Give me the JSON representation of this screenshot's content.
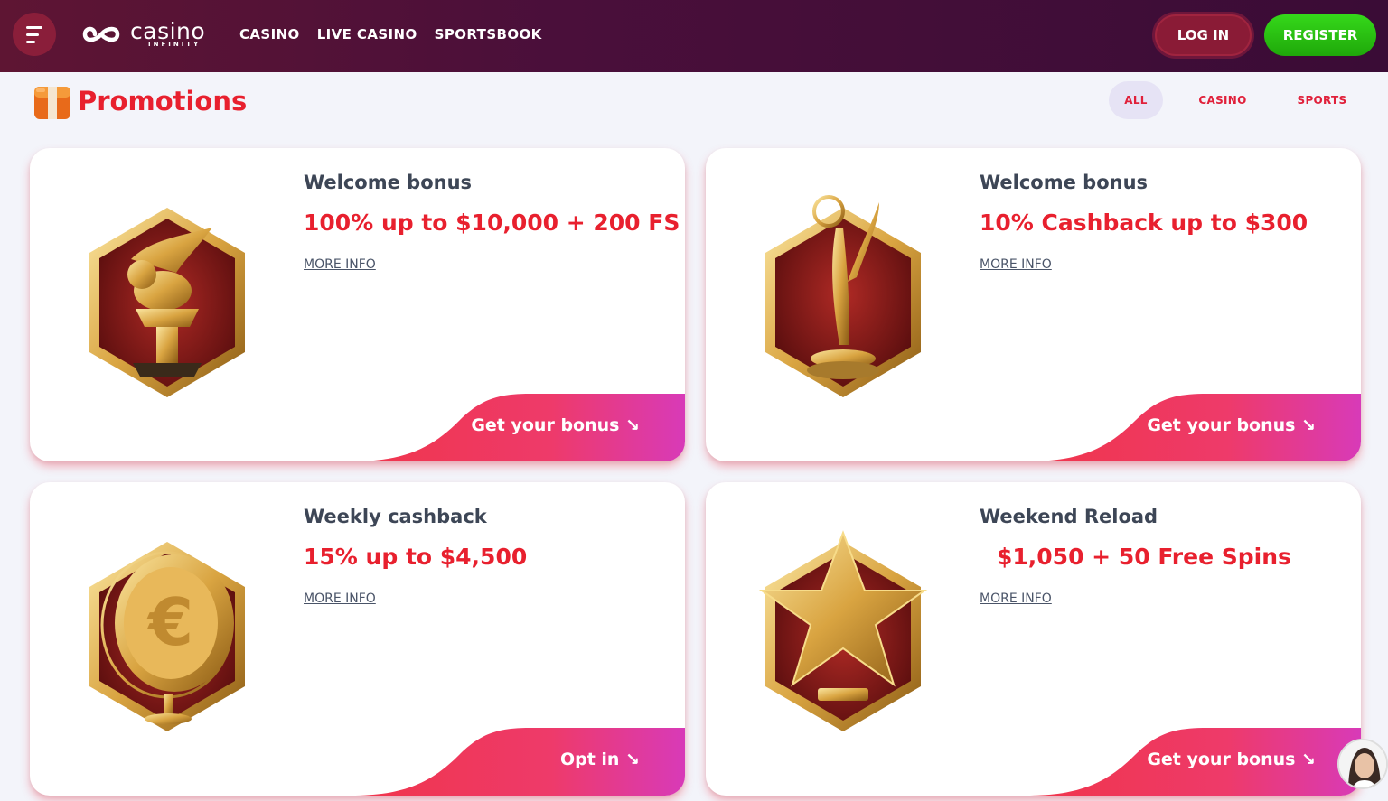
{
  "header": {
    "logo_main": "casino",
    "logo_sub": "INFINITY",
    "nav": [
      "CASINO",
      "LIVE CASINO",
      "SPORTSBOOK"
    ],
    "login": "LOG IN",
    "register": "REGISTER"
  },
  "page": {
    "title": "Promotions",
    "filters": [
      "ALL",
      "CASINO",
      "SPORTS"
    ],
    "active_filter": "ALL"
  },
  "promotions": [
    {
      "title": "Welcome bonus",
      "offer": "100% up to $10,000 + 200 FS",
      "more": "MORE INFO",
      "cta": "Get your bonus ↘",
      "icon": "winged-lion-trophy-icon"
    },
    {
      "title": "Welcome bonus",
      "offer": "10% Cashback up to $300",
      "more": "MORE INFO",
      "cta": "Get your bonus ↘",
      "icon": "award-statue-icon"
    },
    {
      "title": "Weekly cashback",
      "offer": "15% up to $4,500",
      "more": "MORE INFO",
      "cta": "Opt in ↘",
      "icon": "euro-coin-icon"
    },
    {
      "title": "Weekend Reload",
      "offer": "$1,050 + 50 Free Spins",
      "more": "MORE INFO",
      "cta": "Get your bonus ↘",
      "icon": "gold-star-icon"
    }
  ],
  "colors": {
    "header_bg": "#4a0f3a",
    "accent_red": "#e8202e",
    "register_green": "#26b80f",
    "cta_gradient_start": "#f0354a",
    "cta_gradient_end": "#d83ab8"
  }
}
